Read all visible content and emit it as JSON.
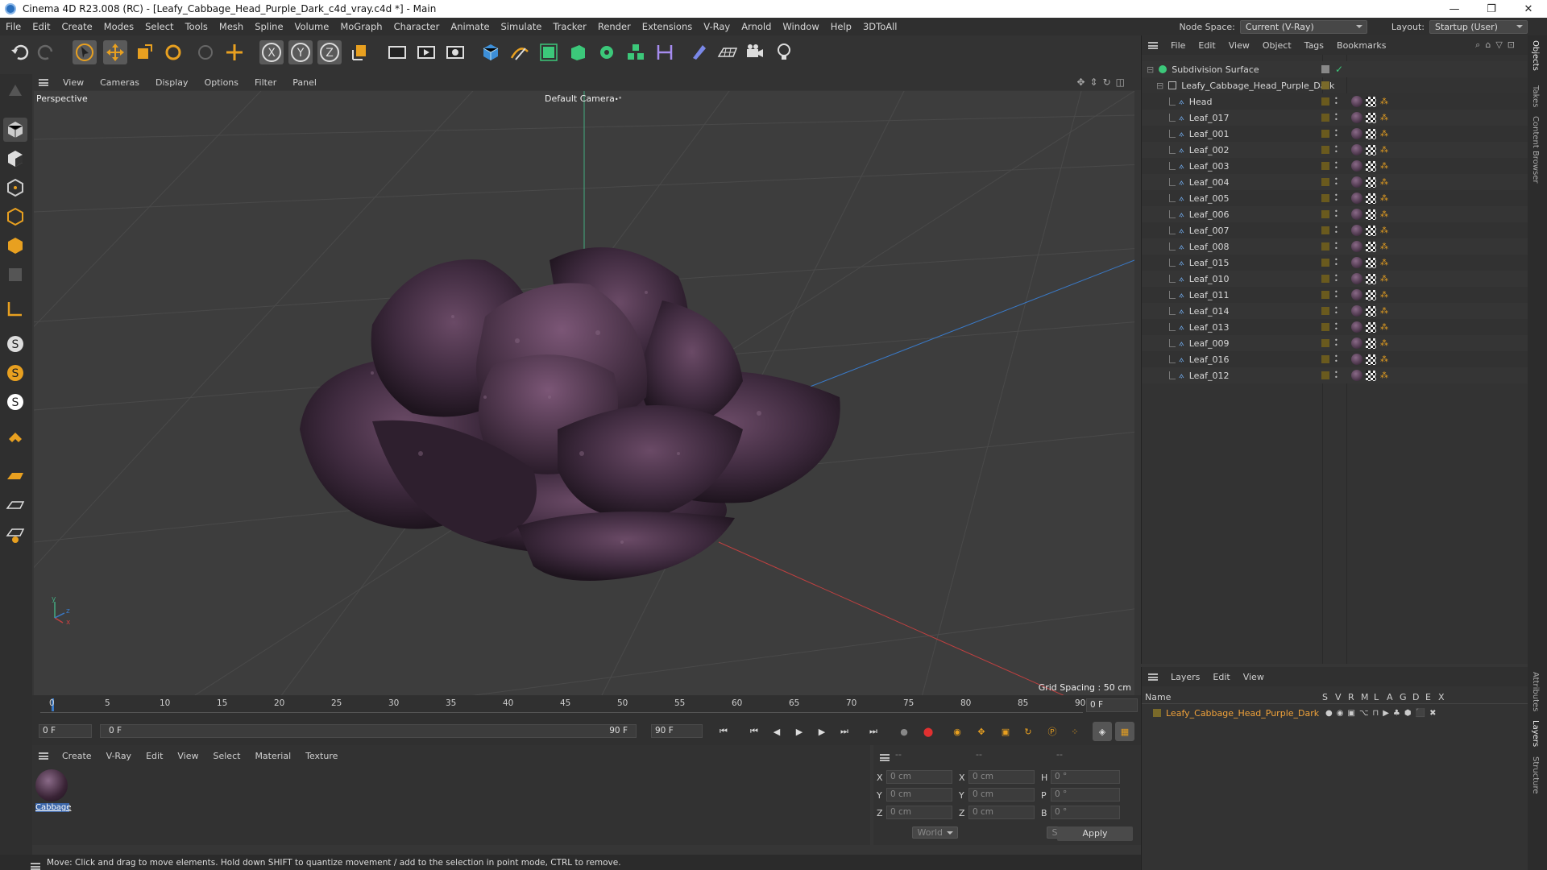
{
  "window": {
    "title": "Cinema 4D R23.008 (RC) - [Leafy_Cabbage_Head_Purple_Dark_c4d_vray.c4d *] - Main",
    "min": "—",
    "max": "❐",
    "close": "✕"
  },
  "menu": [
    "File",
    "Edit",
    "Create",
    "Modes",
    "Select",
    "Tools",
    "Mesh",
    "Spline",
    "Volume",
    "MoGraph",
    "Character",
    "Animate",
    "Simulate",
    "Tracker",
    "Render",
    "Extensions",
    "V-Ray",
    "Arnold",
    "Window",
    "Help",
    "3DToAll"
  ],
  "nodespace": {
    "label": "Node Space:",
    "value": "Current (V-Ray)"
  },
  "layout": {
    "label": "Layout:",
    "value": "Startup (User)"
  },
  "toolbar_icons": [
    "undo-icon",
    "redo-icon",
    "select-icon",
    "move-icon",
    "scale-icon",
    "rotate-icon",
    "live-select-icon",
    "transform-icon",
    "x-axis-icon",
    "y-axis-icon",
    "z-axis-icon",
    "coordinate-system-icon",
    "render-view-icon",
    "render-icon",
    "render-settings-icon",
    "cube-icon",
    "pen-icon",
    "subdivision-icon",
    "extrude-icon",
    "cloner-icon",
    "array-icon",
    "symmetry-icon",
    "deformer-icon",
    "floor-icon",
    "camera-icon",
    "light-icon"
  ],
  "viewport": {
    "menu": [
      "View",
      "Cameras",
      "Display",
      "Options",
      "Filter",
      "Panel"
    ],
    "label": "Perspective",
    "camera": "Default Camera",
    "camera_mark": "•°",
    "grid_spacing": "Grid Spacing : 50 cm",
    "axis": {
      "x": "x",
      "y": "y",
      "z": "z"
    }
  },
  "timeline": {
    "ticks": [
      "0",
      "5",
      "10",
      "15",
      "20",
      "25",
      "30",
      "35",
      "40",
      "45",
      "50",
      "55",
      "60",
      "65",
      "70",
      "75",
      "80",
      "85",
      "90"
    ],
    "current_frame": "0 F",
    "start": "0 F",
    "range_start": "0 F",
    "range_end": "90 F",
    "end": "90 F"
  },
  "material_manager": {
    "menu": [
      "Create",
      "V-Ray",
      "Edit",
      "View",
      "Select",
      "Material",
      "Texture"
    ],
    "materials": [
      {
        "name": "Cabbage"
      }
    ]
  },
  "coord_manager": {
    "headers": [
      "--",
      "--",
      "--"
    ],
    "rows": [
      {
        "a_label": "X",
        "a_val": "0 cm",
        "b_label": "X",
        "b_val": "0 cm",
        "c_label": "H",
        "c_val": "0 °"
      },
      {
        "a_label": "Y",
        "a_val": "0 cm",
        "b_label": "Y",
        "b_val": "0 cm",
        "c_label": "P",
        "c_val": "0 °"
      },
      {
        "a_label": "Z",
        "a_val": "0 cm",
        "b_label": "Z",
        "b_val": "0 cm",
        "c_label": "B",
        "c_val": "0 °"
      }
    ],
    "space": "World",
    "mode": "Scale",
    "apply": "Apply"
  },
  "object_manager": {
    "menu": [
      "File",
      "Edit",
      "View",
      "Object",
      "Tags",
      "Bookmarks"
    ],
    "root": "Subdivision Surface",
    "group": "Leafy_Cabbage_Head_Purple_Dark",
    "objects": [
      "Head",
      "Leaf_017",
      "Leaf_001",
      "Leaf_002",
      "Leaf_003",
      "Leaf_004",
      "Leaf_005",
      "Leaf_006",
      "Leaf_007",
      "Leaf_008",
      "Leaf_015",
      "Leaf_010",
      "Leaf_011",
      "Leaf_014",
      "Leaf_013",
      "Leaf_009",
      "Leaf_016",
      "Leaf_012"
    ]
  },
  "layer_manager": {
    "menu": [
      "Layers",
      "Edit",
      "View"
    ],
    "columns": {
      "name": "Name",
      "flags": [
        "S",
        "V",
        "R",
        "M",
        "L",
        "A",
        "G",
        "D",
        "E",
        "X"
      ]
    },
    "layers": [
      {
        "name": "Leafy_Cabbage_Head_Purple_Dark",
        "color": "#7a6a2a"
      }
    ]
  },
  "right_tabs": [
    "Objects",
    "Takes",
    "Content Browser",
    "Attributes",
    "Layers",
    "Structure"
  ],
  "status": "Move: Click and drag to move elements. Hold down SHIFT to quantize movement / add to the selection in point mode, CTRL to remove.",
  "colors": {
    "accent": "#e8a020",
    "selection": "#f0a23a",
    "axis_x": "#c04040",
    "axis_y": "#40b080",
    "axis_z": "#3a7ac8"
  }
}
